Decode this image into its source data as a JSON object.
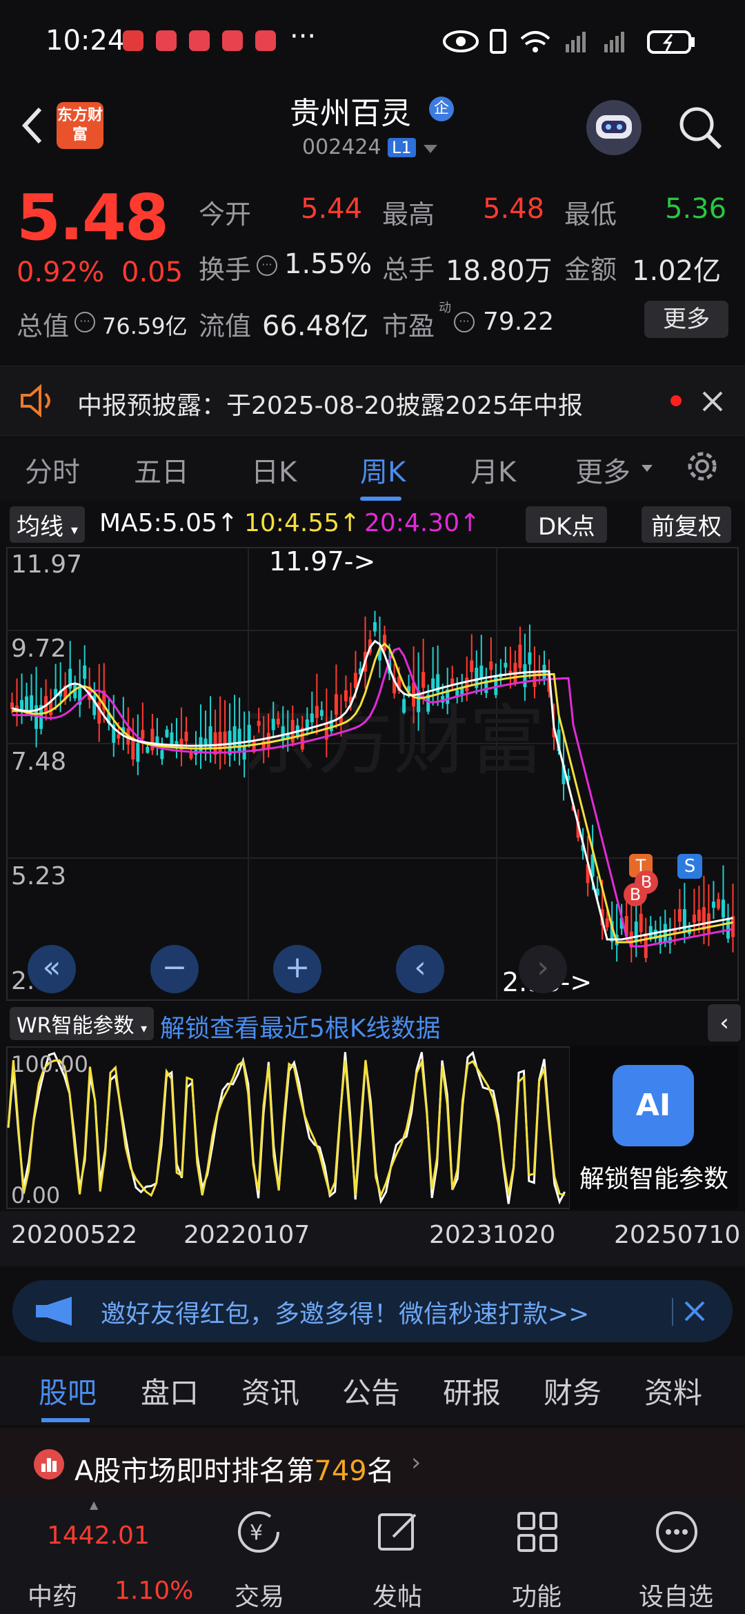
{
  "status": {
    "time": "10:24",
    "more": "···"
  },
  "header": {
    "logo_text": "东方财富",
    "stock_name": "贵州百灵",
    "badge": "企",
    "code": "002424",
    "level": "L1"
  },
  "quote": {
    "price": "5.48",
    "change_pct": "0.92%",
    "change": "0.05",
    "open_label": "今开",
    "open": "5.44",
    "high_label": "最高",
    "high": "5.48",
    "low_label": "最低",
    "low": "5.36",
    "turnover_label": "换手",
    "turnover": "1.55%",
    "volume_label": "总手",
    "volume": "18.80万",
    "amount_label": "金额",
    "amount": "1.02亿",
    "mktcap_label": "总值",
    "mktcap": "76.59亿",
    "float_label": "流值",
    "float": "66.48亿",
    "pe_label": "市盈",
    "pe_sup": "动",
    "pe": "79.22",
    "more_label": "更多"
  },
  "notice": {
    "text": "中报预披露：于2025-08-20披露2025年中报"
  },
  "tabs": [
    "分时",
    "五日",
    "日K",
    "周K",
    "月K",
    "更多"
  ],
  "active_tab": "周K",
  "ma": {
    "selector": "均线",
    "ma5": "MA5:5.05↑",
    "ma10": "10:4.55↑",
    "ma20": "20:4.30↑",
    "dk": "DK点",
    "adjust": "前复权"
  },
  "kchart": {
    "price_labels": [
      "11.97",
      "9.72",
      "7.48",
      "5.23",
      "2.98"
    ],
    "high_marker": "11.97->",
    "low_marker": "2.98->",
    "watermark": "东方财富",
    "signals": [
      "T",
      "B",
      "B",
      "S"
    ],
    "controls": [
      "«",
      "−",
      "+",
      "‹",
      "›"
    ],
    "colors": {
      "up": "#ff3b30",
      "down": "#20d0d0",
      "ma5": "#ffffff",
      "ma10": "#f5e03c",
      "ma20": "#e22bd8"
    }
  },
  "wr": {
    "selector": "WR智能参数",
    "unlock_text": "解锁查看最近5根K线数据",
    "top_label": "100.00",
    "bottom_label": "0.00",
    "ai_label": "解锁智能参数",
    "ai_icon_text": "AI"
  },
  "dates": [
    "20200522",
    "20220107",
    "20231020",
    "20250710"
  ],
  "promo": {
    "text": "邀好友得红包，多邀多得！微信秒速打款>>"
  },
  "bottom_tabs": [
    "股吧",
    "盘口",
    "资讯",
    "公告",
    "研报",
    "财务",
    "资料"
  ],
  "active_bottom_tab": "股吧",
  "rank": {
    "prefix": "A股市场即时排名第",
    "number": "749",
    "suffix": "名"
  },
  "nav": {
    "index_value": "1442.01",
    "index_name": "中药",
    "index_pct": "1.10%",
    "items": [
      "交易",
      "发帖",
      "功能",
      "设自选"
    ]
  }
}
